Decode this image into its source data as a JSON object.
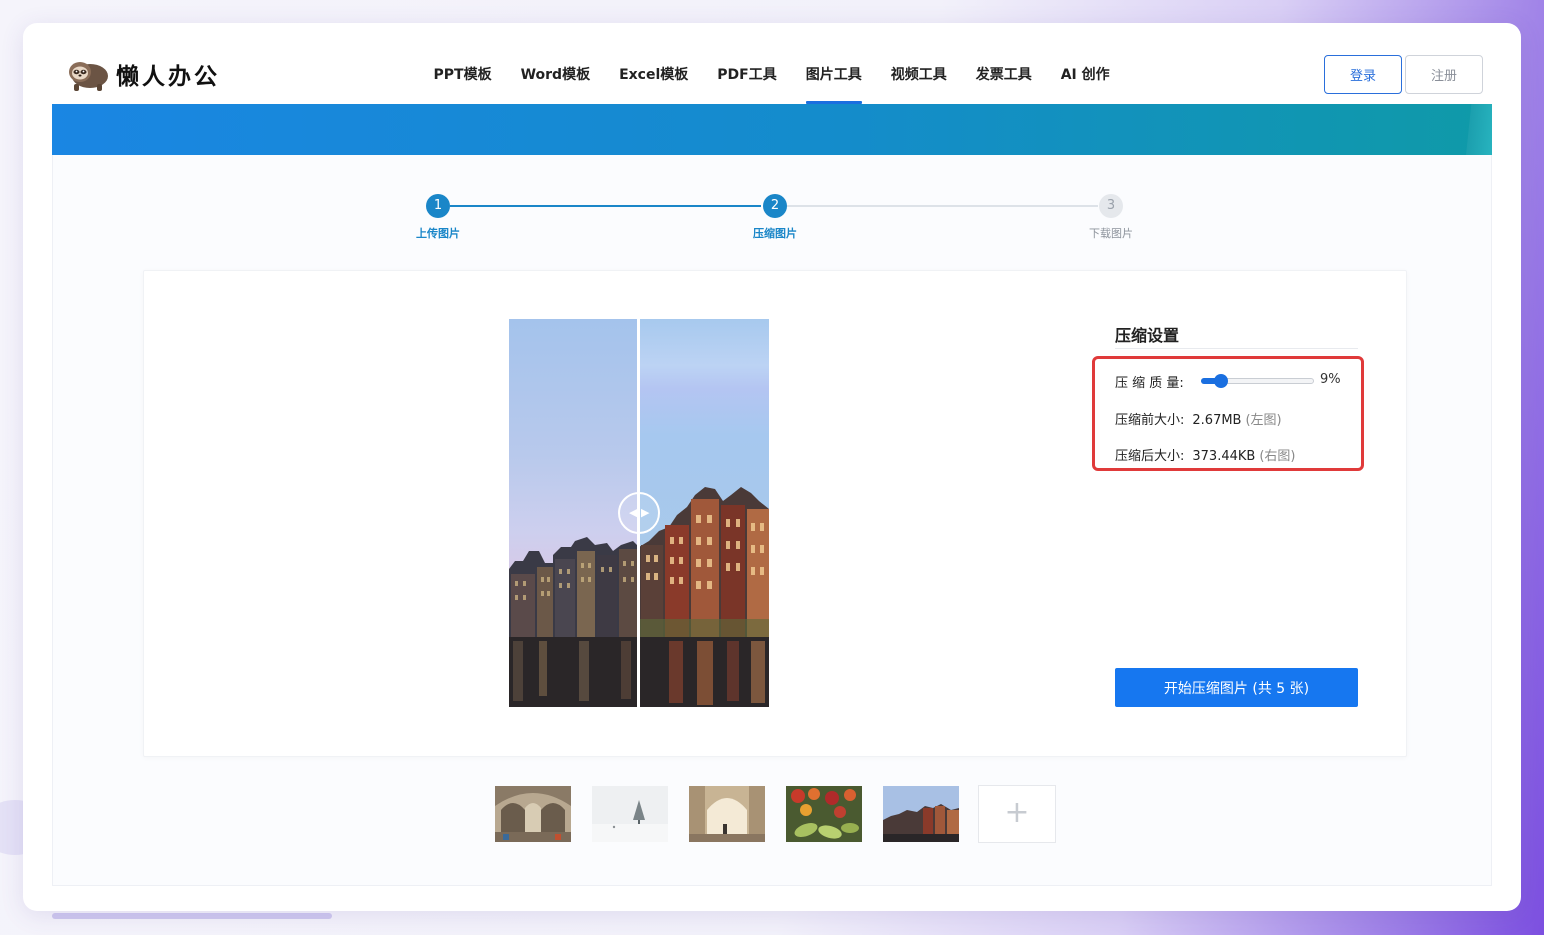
{
  "brand": {
    "name": "懒人办公"
  },
  "nav": {
    "items": [
      {
        "label": "PPT模板"
      },
      {
        "label": "Word模板"
      },
      {
        "label": "Excel模板"
      },
      {
        "label": "PDF工具"
      },
      {
        "label": "图片工具",
        "active": true
      },
      {
        "label": "视频工具"
      },
      {
        "label": "发票工具"
      },
      {
        "label": "AI 创作"
      }
    ]
  },
  "auth": {
    "login_label": "登录",
    "register_label": "注册"
  },
  "steps": [
    {
      "num": "1",
      "label": "上传图片",
      "state": "done"
    },
    {
      "num": "2",
      "label": "压缩图片",
      "state": "current"
    },
    {
      "num": "3",
      "label": "下载图片",
      "state": "todo"
    }
  ],
  "settings": {
    "title": "压缩设置",
    "quality_label": "压 缩 质 量:",
    "quality_value": "9%",
    "quality_fraction": 0.09,
    "before_label": "压缩前大小:",
    "before_value": "2.67MB",
    "before_hint": "(左图)",
    "after_label": "压缩后大小:",
    "after_value": "373.44KB",
    "after_hint": "(右图)",
    "highlight_color": "#e03a3a"
  },
  "start_button": {
    "label": "开始压缩图片 (共 5 张)"
  },
  "thumbnails": [
    {
      "name": "thumbnail-hall"
    },
    {
      "name": "thumbnail-snow"
    },
    {
      "name": "thumbnail-arch"
    },
    {
      "name": "thumbnail-fruit"
    },
    {
      "name": "thumbnail-houses"
    }
  ],
  "add_image": {
    "label": "+"
  },
  "colors": {
    "accent": "#1a6fe0",
    "step": "#1a86c8"
  }
}
